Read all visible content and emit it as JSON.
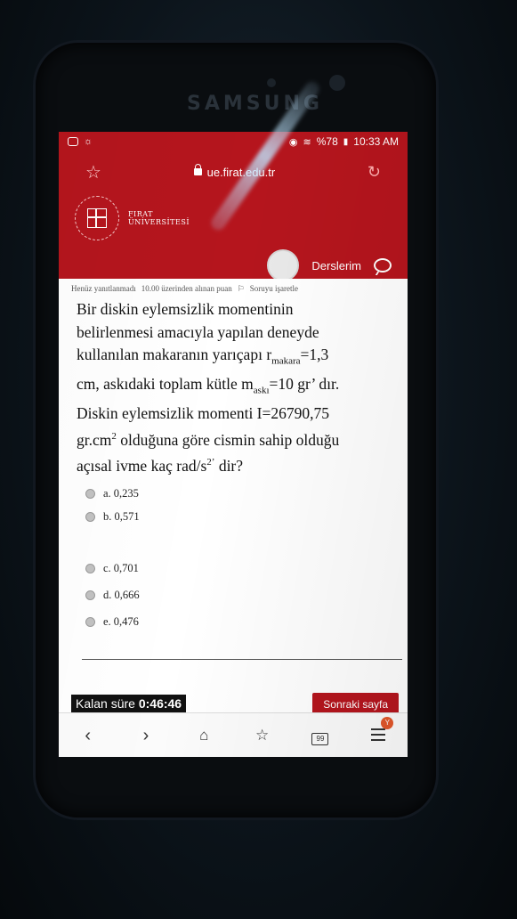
{
  "device": {
    "brand_text": "SAMSUNG"
  },
  "status_bar": {
    "battery": "%78",
    "time": "10:33 AM"
  },
  "browser": {
    "url": "ue.firat.edu.tr"
  },
  "university": {
    "name_line1": "FIRAT",
    "name_line2": "ÜNİVERSİTESİ"
  },
  "header": {
    "courses_label": "Derslerim"
  },
  "question_info": {
    "status": "Henüz yanıtlanmadı",
    "points": "10.00 üzerinden alınan puan",
    "flag": "Soruyu işaretle"
  },
  "question": {
    "line1": "Bir diskin eylemsizlik momentinin",
    "line2": "belirlenmesi amacıyla yapılan deneyde",
    "line3_a": "kullanılan makaranın yarıçapı r",
    "line3_sub": "makara",
    "line3_b": "=1,3",
    "line4_a": "cm, askıdaki toplam kütle m",
    "line4_sub": "askı",
    "line4_b": "=10 gr’ dır.",
    "line5": "Diskin eylemsizlik momenti I=26790,75",
    "line6_a": "gr.cm",
    "line6_sup": "2",
    "line6_b": " olduğuna göre cismin sahip olduğu",
    "line7_a": "açısal ivme kaç rad/s",
    "line7_sup": "2’",
    "line7_b": " dir?"
  },
  "options": [
    "a. 0,235",
    "b. 0,571",
    "c. 0,701",
    "d. 0,666",
    "e. 0,476"
  ],
  "footer": {
    "timer_label": "Kalan süre",
    "timer_value": "0:46:46",
    "next_button": "Sonraki sayfa"
  },
  "nav": {
    "tabs_count": "99",
    "badge": "Y"
  }
}
